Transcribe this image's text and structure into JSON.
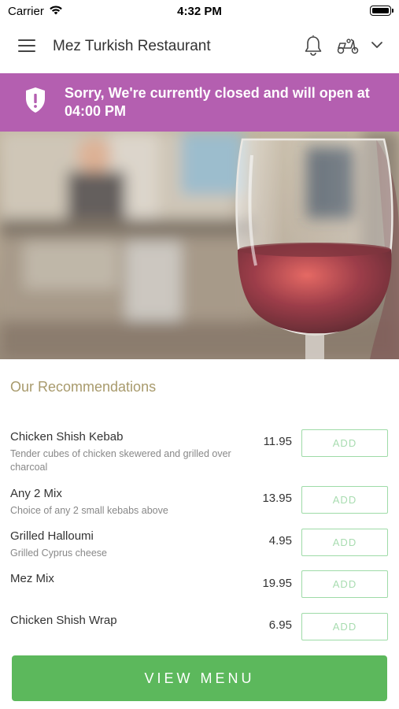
{
  "status_bar": {
    "carrier": "Carrier",
    "time": "4:32 PM"
  },
  "header": {
    "title": "Mez Turkish Restaurant"
  },
  "banner": {
    "message": "Sorry, We're currently closed and will open at 04:00 PM",
    "color": "#b45fb0"
  },
  "recommendations": {
    "title": "Our Recommendations",
    "add_label": "ADD",
    "items": [
      {
        "name": "Chicken Shish Kebab",
        "description": "Tender cubes of chicken skewered and grilled over charcoal",
        "price": "11.95"
      },
      {
        "name": "Any 2 Mix",
        "description": "Choice of any 2 small kebabs above",
        "price": "13.95"
      },
      {
        "name": "Grilled Halloumi",
        "description": "Grilled Cyprus cheese",
        "price": "4.95"
      },
      {
        "name": "Mez Mix",
        "description": "",
        "price": "19.95"
      },
      {
        "name": "Chicken Shish Wrap",
        "description": "",
        "price": "6.95"
      }
    ]
  },
  "footer": {
    "view_menu_label": "VIEW MENU",
    "color": "#5cb85c"
  },
  "icons": [
    "menu-icon",
    "bell-icon",
    "scooter-icon",
    "chevron-down-icon",
    "shield-icon",
    "wifi-icon",
    "battery-icon"
  ]
}
